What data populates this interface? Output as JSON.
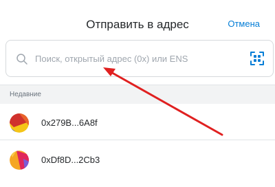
{
  "header": {
    "title": "Отправить в адрес",
    "cancel_label": "Отмена"
  },
  "search": {
    "placeholder": "Поиск, открытый адрес (0x) или ENS",
    "value": "",
    "search_icon": "search-icon",
    "qr_icon": "qr-scan-icon"
  },
  "recent": {
    "section_label": "Недавние",
    "items": [
      {
        "address": "0x279B...6A8f",
        "avatar_colors": [
          "#f5c518",
          "#d0312d",
          "#e8632b"
        ]
      },
      {
        "address": "0xDf8D...2Cb3",
        "avatar_colors": [
          "#f5a623",
          "#e0285a",
          "#7b5bd6"
        ]
      }
    ]
  },
  "colors": {
    "accent": "#037dd6",
    "annotation_arrow": "#e02020"
  }
}
